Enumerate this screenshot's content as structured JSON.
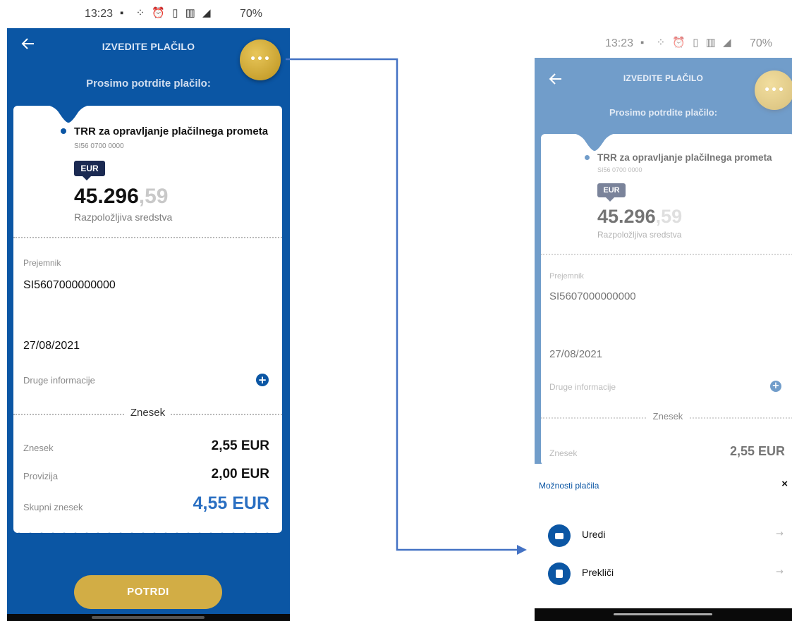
{
  "colors": {
    "primary_blue": "#0b56a4",
    "gold": "#d2ad45",
    "total_blue": "#2a6fc2",
    "connector": "#4472c4"
  },
  "status_bar": {
    "time": "13:23",
    "battery": "70%"
  },
  "left_screen": {
    "header": {
      "back_icon": "arrow-left-icon",
      "title": "IZVEDITE PLAČILO",
      "more_icon": "ellipsis-icon",
      "more_dots": "•••"
    },
    "subtitle": "Prosimo potrdite plačilo:",
    "account": {
      "name": "TRR za opravljanje plačilnega prometa",
      "iban": "SI56 0700 0000",
      "currency": "EUR",
      "balance_int": "45.296",
      "balance_dec": ",59",
      "balance_label": "Razpoložljiva sredstva"
    },
    "recipient": {
      "label": "Prejemnik",
      "value": "SI5607000000000"
    },
    "date": "27/08/2021",
    "other_info": {
      "label": "Druge informacije",
      "icon": "plus-circle-icon"
    },
    "amount_section": {
      "title": "Znesek",
      "rows": [
        {
          "label": "Znesek",
          "value": "2,55 EUR"
        },
        {
          "label": "Provizija",
          "value": "2,00 EUR"
        },
        {
          "label": "Skupni znesek",
          "value": "4,55 EUR"
        }
      ]
    },
    "confirm_button": "POTRDI"
  },
  "right_screen": {
    "bottom_sheet": {
      "title": "Možnosti plačila",
      "close": "×",
      "options": [
        {
          "label": "Uredi",
          "icon": "wallet-icon"
        },
        {
          "label": "Prekliči",
          "icon": "trash-icon"
        }
      ],
      "arrow": "→"
    }
  }
}
